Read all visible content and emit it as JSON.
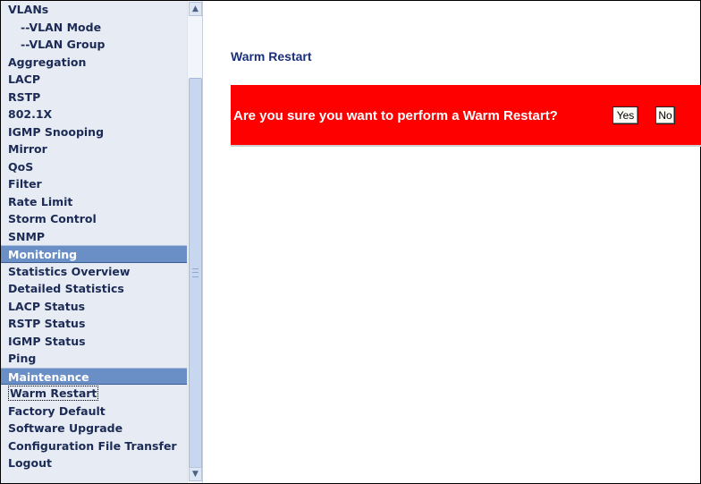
{
  "sidebar": {
    "items": [
      {
        "label": "VLANs",
        "type": "item"
      },
      {
        "label": "--VLAN Mode",
        "type": "sub"
      },
      {
        "label": "--VLAN Group",
        "type": "sub"
      },
      {
        "label": "Aggregation",
        "type": "item"
      },
      {
        "label": "LACP",
        "type": "item"
      },
      {
        "label": "RSTP",
        "type": "item"
      },
      {
        "label": "802.1X",
        "type": "item"
      },
      {
        "label": "IGMP Snooping",
        "type": "item"
      },
      {
        "label": "Mirror",
        "type": "item"
      },
      {
        "label": "QoS",
        "type": "item"
      },
      {
        "label": "Filter",
        "type": "item"
      },
      {
        "label": "Rate Limit",
        "type": "item"
      },
      {
        "label": "Storm Control",
        "type": "item"
      },
      {
        "label": "SNMP",
        "type": "item"
      },
      {
        "label": "Monitoring",
        "type": "section"
      },
      {
        "label": "Statistics Overview",
        "type": "item"
      },
      {
        "label": "Detailed Statistics",
        "type": "item"
      },
      {
        "label": "LACP Status",
        "type": "item"
      },
      {
        "label": "RSTP Status",
        "type": "item"
      },
      {
        "label": "IGMP Status",
        "type": "item"
      },
      {
        "label": "Ping",
        "type": "item"
      },
      {
        "label": "Maintenance",
        "type": "section"
      },
      {
        "label": "Warm Restart",
        "type": "item",
        "active": true
      },
      {
        "label": "Factory Default",
        "type": "item"
      },
      {
        "label": "Software Upgrade",
        "type": "item"
      },
      {
        "label": "Configuration File Transfer",
        "type": "item"
      },
      {
        "label": "Logout",
        "type": "item"
      }
    ],
    "scroll_up_icon": "arrow-up",
    "scroll_down_icon": "arrow-down"
  },
  "main": {
    "title": "Warm Restart",
    "confirm": {
      "message": "Are you sure you want to perform a Warm Restart?",
      "yes_label": "Yes",
      "no_label": "No"
    }
  },
  "colors": {
    "sidebar_bg": "#e7ebf3",
    "section_bg": "#6a8fc6",
    "title_color": "#1a2f7a",
    "panel_bg": "#ff0000"
  }
}
